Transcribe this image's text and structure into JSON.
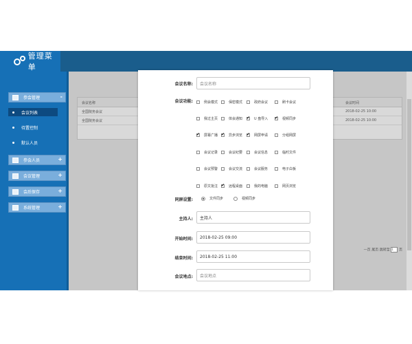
{
  "app_title": "管理菜单",
  "sidebar": {
    "groups": [
      {
        "label": "参会管理",
        "toggle": "-"
      },
      {
        "label": "参会人员",
        "toggle": "+"
      },
      {
        "label": "会议管理",
        "toggle": "+"
      },
      {
        "label": "会后保存",
        "toggle": "+"
      },
      {
        "label": "系统管理",
        "toggle": "+"
      }
    ],
    "subitems": [
      "会议列表",
      "待置控制",
      "默认人员"
    ]
  },
  "table": {
    "headers": [
      "会议名称",
      "会议时间"
    ],
    "rows": [
      {
        "name": "全国院务会议",
        "time": "2018-02-25 10:00"
      },
      {
        "name": "全国院务会议",
        "time": "2018-02-25 10:00"
      }
    ]
  },
  "pager": {
    "text": "一页 尾页 跳转至",
    "page": "1",
    "suffix": "页"
  },
  "modal": {
    "name_label": "会议名称:",
    "name_placeholder": "会议名称",
    "func_label": "会议功能:",
    "options": [
      [
        "例会模式",
        "保密模式",
        "政府会议",
        "刷卡会议"
      ],
      [
        "我过主页",
        "体会通知",
        "U 盘导入",
        "视频同步"
      ],
      [
        "屏幕广播",
        "异步浏览",
        "网屏申请",
        "分组网屏"
      ],
      [
        "会议记录",
        "会议纪要",
        "会议信息",
        "临时文件"
      ],
      [
        "会议预警",
        "会议交流",
        "会议服务",
        "电子白板"
      ],
      [
        "原文批注",
        "远程桌面",
        "我的电脑",
        "网页浏览"
      ]
    ],
    "checked": [
      [
        false,
        false,
        false,
        false
      ],
      [
        false,
        false,
        true,
        true
      ],
      [
        true,
        true,
        true,
        false
      ],
      [
        false,
        false,
        false,
        false
      ],
      [
        false,
        false,
        false,
        false
      ],
      [
        false,
        true,
        false,
        false
      ]
    ],
    "sync_label": "同屏设置:",
    "sync_options": [
      "文件同步",
      "视频同步"
    ],
    "sync_selected": 0,
    "host_label": "主持人:",
    "host_value": "主持人",
    "start_label": "开始时间:",
    "start_value": "2018-02-25 09:00",
    "end_label": "结束时间:",
    "end_value": "2018-02-25 11:00",
    "place_label": "会议地点:",
    "place_placeholder": "会议地点"
  }
}
